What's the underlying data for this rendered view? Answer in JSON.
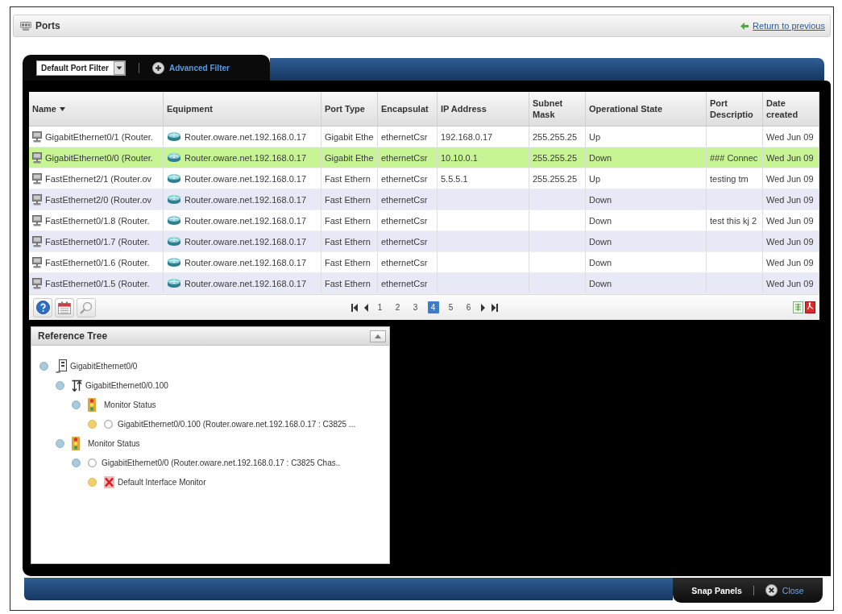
{
  "title_bar": {
    "title": "Ports",
    "back_link": "Return to previous"
  },
  "filter_tab": {
    "filter": "Default Port Filter",
    "advanced_filter": "Advanced Filter"
  },
  "table": {
    "columns": [
      {
        "label": "Name",
        "sorted": true
      },
      {
        "label": "Equipment",
        "sorted": false
      },
      {
        "label": "Port Type",
        "sorted": false
      },
      {
        "label": "Encapsulat",
        "sorted": false
      },
      {
        "label": "IP Address",
        "sorted": false
      },
      {
        "label": "Subnet Mask",
        "sorted": false
      },
      {
        "label": "Operational State",
        "sorted": false
      },
      {
        "label": "Port Descriptio",
        "sorted": false
      },
      {
        "label": "Date created",
        "sorted": false
      }
    ],
    "rows": [
      {
        "selected": false,
        "cells": [
          "GigabitEthernet0/1 (Router.",
          "Router.oware.net.192.168.0.17",
          "Gigabit Ethe",
          "ethernetCsr",
          "192.168.0.17",
          "255.255.25",
          "Up",
          null,
          "Wed Jun 09"
        ]
      },
      {
        "selected": true,
        "cells": [
          "GigabitEthernet0/0 (Router.",
          "Router.oware.net.192.168.0.17",
          "Gigabit Ethe",
          "ethernetCsr",
          "10.10.0.1",
          "255.255.25",
          "Down",
          "### Connec",
          "Wed Jun 09"
        ]
      },
      {
        "selected": false,
        "cells": [
          "FastEthernet2/1 (Router.ov",
          "Router.oware.net.192.168.0.17",
          "Fast Ethern",
          "ethernetCsr",
          "5.5.5.1",
          "255.255.25",
          "Up",
          "testing tm",
          "Wed Jun 09"
        ]
      },
      {
        "selected": false,
        "cells": [
          "FastEthernet2/0 (Router.ov",
          "Router.oware.net.192.168.0.17",
          "Fast Ethern",
          "ethernetCsr",
          null,
          null,
          "Down",
          null,
          "Wed Jun 09"
        ]
      },
      {
        "selected": false,
        "cells": [
          "FastEthernet0/1.8 (Router.",
          "Router.oware.net.192.168.0.17",
          "Fast Ethern",
          "ethernetCsr",
          null,
          null,
          "Down",
          "test this kj 2",
          "Wed Jun 09"
        ]
      },
      {
        "selected": false,
        "cells": [
          "FastEthernet0/1.7 (Router.",
          "Router.oware.net.192.168.0.17",
          "Fast Ethern",
          "ethernetCsr",
          null,
          null,
          "Down",
          null,
          "Wed Jun 09"
        ]
      },
      {
        "selected": false,
        "cells": [
          "FastEthernet0/1.6 (Router.",
          "Router.oware.net.192.168.0.17",
          "Fast Ethern",
          "ethernetCsr",
          null,
          null,
          "Down",
          null,
          "Wed Jun 09"
        ]
      },
      {
        "selected": false,
        "cells": [
          "FastEthernet0/1.5 (Router.",
          "Router.oware.net.192.168.0.17",
          "Fast Ethern",
          "ethernetCsr",
          null,
          null,
          "Down",
          null,
          "Wed Jun 09"
        ]
      }
    ]
  },
  "pagination": {
    "pages": [
      {
        "label": "1",
        "selected": false
      },
      {
        "label": "2",
        "selected": false
      },
      {
        "label": "3",
        "selected": false
      },
      {
        "label": "4",
        "selected": true
      },
      {
        "label": "5",
        "selected": false
      },
      {
        "label": "6",
        "selected": false
      }
    ]
  },
  "reference_tree": {
    "title": "Reference Tree",
    "nodes": [
      {
        "kind": "interface",
        "label": "GigabitEthernet0/0",
        "children": [
          {
            "kind": "subinterface",
            "label": "GigabitEthernet0/0.100",
            "children": [
              {
                "kind": "status",
                "label": "Monitor Status",
                "children": [
                  {
                    "kind": "item",
                    "label": "GigabitEthernet0/0.100 (Router.oware.net.192.168.0.17 : C3825 ..."
                  }
                ]
              }
            ]
          },
          {
            "kind": "status",
            "label": "Monitor Status",
            "children": [
              {
                "kind": "item",
                "label": "GigabitEthernet0/0 (Router.oware.net.192.168.0.17 : C3825 Chas..",
                "children": [
                  {
                    "kind": "alarm",
                    "label": "Default Interface Monitor"
                  }
                ]
              }
            ]
          }
        ]
      }
    ]
  },
  "bottom_bar": {
    "snap_panels": "Snap Panels",
    "close": "Close"
  }
}
